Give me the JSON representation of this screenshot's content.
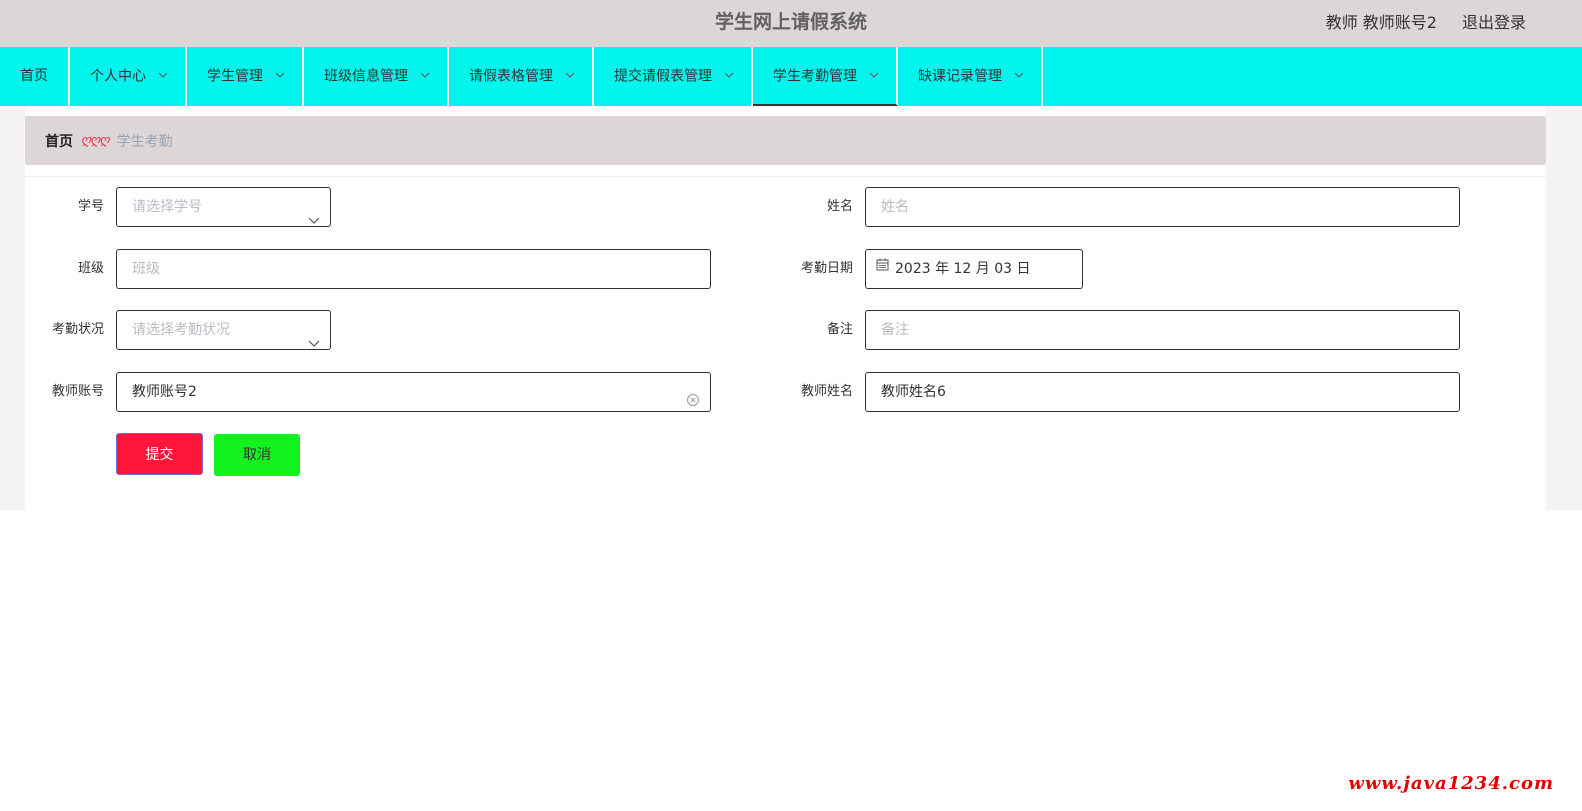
{
  "header": {
    "title": "学生网上请假系统",
    "user": "教师 教师账号2",
    "logout": "退出登录"
  },
  "nav": {
    "items": [
      {
        "label": "首页",
        "has_dropdown": false,
        "active": false
      },
      {
        "label": "个人中心",
        "has_dropdown": true,
        "active": false
      },
      {
        "label": "学生管理",
        "has_dropdown": true,
        "active": false
      },
      {
        "label": "班级信息管理",
        "has_dropdown": true,
        "active": false
      },
      {
        "label": "请假表格管理",
        "has_dropdown": true,
        "active": false
      },
      {
        "label": "提交请假表管理",
        "has_dropdown": true,
        "active": false
      },
      {
        "label": "学生考勤管理",
        "has_dropdown": true,
        "active": true
      },
      {
        "label": "缺课记录管理",
        "has_dropdown": true,
        "active": false
      }
    ]
  },
  "breadcrumb": {
    "home": "首页",
    "separator": "ღღღ",
    "current": "学生考勤"
  },
  "form": {
    "student_id": {
      "label": "学号",
      "placeholder": "请选择学号",
      "value": ""
    },
    "name": {
      "label": "姓名",
      "placeholder": "姓名",
      "value": ""
    },
    "class": {
      "label": "班级",
      "placeholder": "班级",
      "value": ""
    },
    "attendance_date": {
      "label": "考勤日期",
      "value": "2023 年 12 月 03 日"
    },
    "attendance_status": {
      "label": "考勤状况",
      "placeholder": "请选择考勤状况",
      "value": ""
    },
    "remark": {
      "label": "备注",
      "placeholder": "备注",
      "value": ""
    },
    "teacher_account": {
      "label": "教师账号",
      "value": "教师账号2"
    },
    "teacher_name": {
      "label": "教师姓名",
      "value": "教师姓名6"
    },
    "submit_label": "提交",
    "cancel_label": "取消"
  },
  "watermark": "www.java1234.com",
  "colors": {
    "header_bg": "#ddd6d6",
    "nav_bg": "#00f5ed",
    "submit_bg": "#ff1638",
    "cancel_bg": "#11f21f",
    "watermark": "#e00000"
  }
}
